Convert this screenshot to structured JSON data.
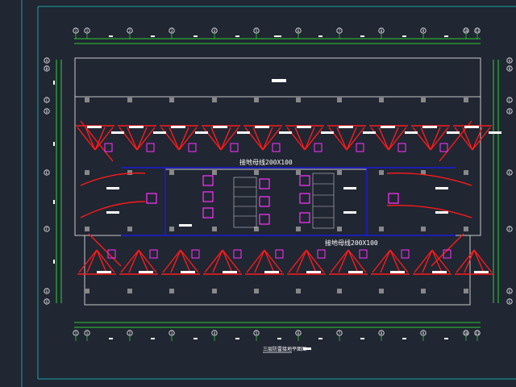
{
  "drawing": {
    "axis_labels_top": [
      "1",
      "1",
      "2",
      "3",
      "4",
      "5",
      "6",
      "7",
      "8",
      "9",
      "10",
      "11"
    ],
    "axis_labels_left": [
      "A",
      "B",
      "C",
      "D",
      "E",
      "F",
      "G"
    ],
    "annotation_upper": "接地母线200X100",
    "annotation_lower": "接地母线200X100",
    "bottom_caption": "三层防雷接地平面图",
    "colors": {
      "background": "#202632",
      "frame": "#1aa3a3",
      "wall": "#c8c8c8",
      "wire": "#ff1a1a",
      "device": "#ff33ff",
      "bus": "#1a1aff",
      "dim": "#33ff33",
      "text": "#ffffff"
    }
  }
}
